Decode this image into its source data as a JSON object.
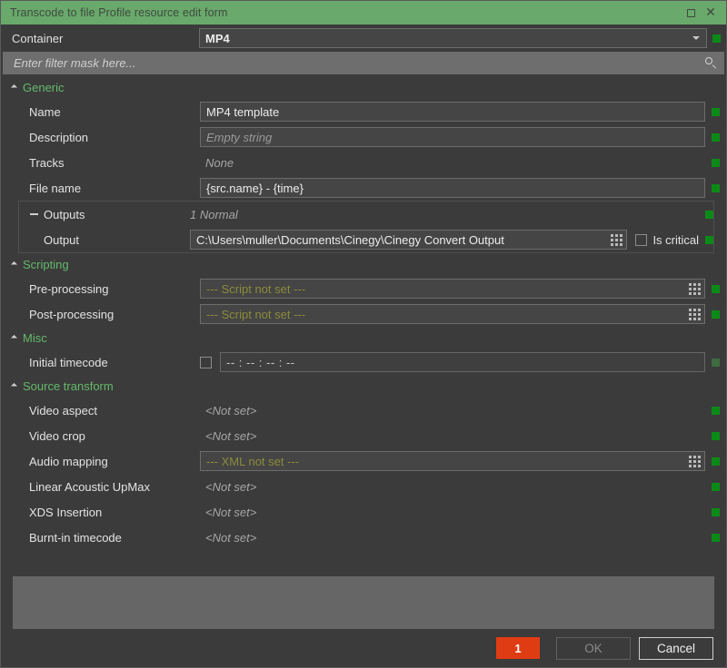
{
  "window": {
    "title": "Transcode to file Profile resource edit form",
    "buttons": {
      "maximize": "maximize-icon",
      "close": "close-icon"
    }
  },
  "container": {
    "label": "Container",
    "value": "MP4",
    "status": "ok"
  },
  "filter": {
    "placeholder": "Enter filter mask here...",
    "value": "",
    "icon": "search-icon"
  },
  "sections": [
    {
      "title": "Generic",
      "rows": [
        {
          "name": "Name",
          "kind": "field",
          "value": "MP4 template",
          "status": "ok"
        },
        {
          "name": "Description",
          "kind": "field-placeholder",
          "value": "Empty string",
          "status": "ok"
        },
        {
          "name": "Tracks",
          "kind": "text",
          "value": "None",
          "status": "ok"
        },
        {
          "name": "File name",
          "kind": "field",
          "value": "{src.name} - {time}",
          "status": "ok"
        }
      ],
      "group": {
        "name": "Outputs",
        "summary": "1 Normal",
        "status": "ok",
        "rows": [
          {
            "name": "Output",
            "kind": "field-browse",
            "value": "C:\\Users\\muller\\Documents\\Cinegy\\Cinegy Convert Output",
            "checkbox_label": "Is critical",
            "checkbox_checked": false,
            "status": "ok"
          }
        ]
      }
    },
    {
      "title": "Scripting",
      "rows": [
        {
          "name": "Pre-processing",
          "kind": "field-script",
          "value": "--- Script not set ---",
          "status": "ok"
        },
        {
          "name": "Post-processing",
          "kind": "field-script",
          "value": "--- Script not set ---",
          "status": "ok"
        }
      ]
    },
    {
      "title": "Misc",
      "rows": [
        {
          "name": "Initial timecode",
          "kind": "field-check",
          "value": "-- : -- : -- : --",
          "checkbox_checked": false,
          "status": "dim"
        }
      ]
    },
    {
      "title": "Source transform",
      "rows": [
        {
          "name": "Video aspect",
          "kind": "text",
          "value": "<Not set>",
          "status": "ok"
        },
        {
          "name": "Video crop",
          "kind": "text",
          "value": "<Not set>",
          "status": "ok"
        },
        {
          "name": "Audio mapping",
          "kind": "field-script-browse",
          "value": "--- XML not set ---",
          "status": "ok"
        },
        {
          "name": "Linear Acoustic UpMax",
          "kind": "text",
          "value": "<Not set>",
          "status": "ok"
        },
        {
          "name": "XDS Insertion",
          "kind": "text",
          "value": "<Not set>",
          "status": "ok"
        },
        {
          "name": "Burnt-in timecode",
          "kind": "text",
          "value": "<Not set>",
          "status": "ok"
        }
      ]
    }
  ],
  "footer": {
    "error_count": "1",
    "ok_label": "OK",
    "cancel_label": "Cancel",
    "ok_enabled": false
  },
  "colors": {
    "titlebar": "#69a96b",
    "section_title": "#64b96a",
    "status_ok": "#0c8a18",
    "status_dim": "#3e6b3f",
    "script_text": "#8b8b3c",
    "error_badge": "#e03c14",
    "window_bg": "#3b3b3b",
    "field_bg": "#454545"
  }
}
